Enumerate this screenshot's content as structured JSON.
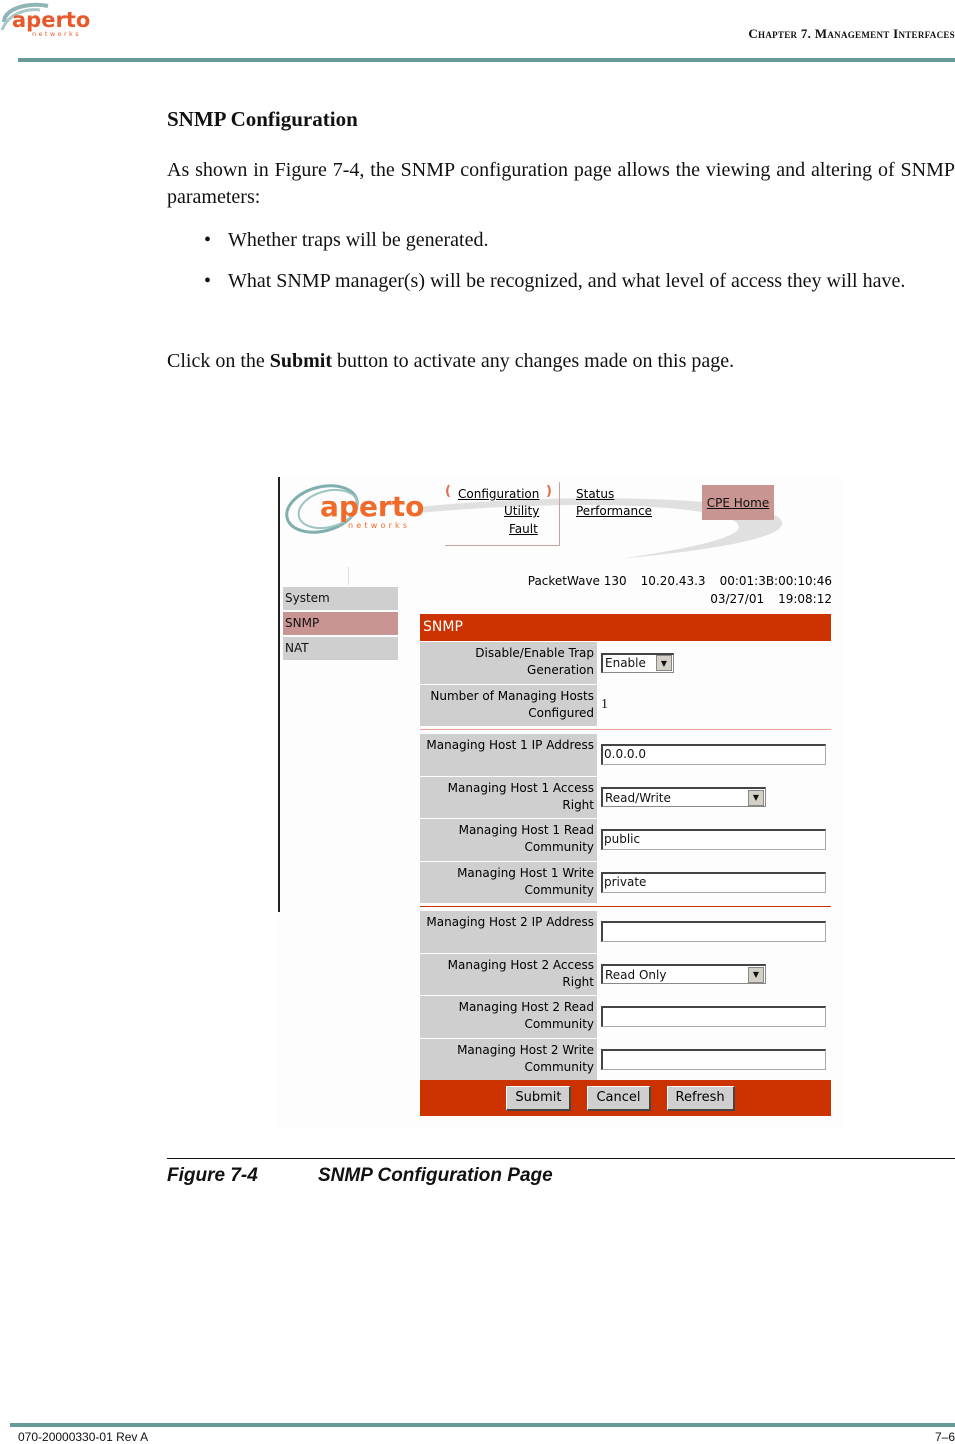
{
  "header": {
    "logo_text": "aperto",
    "logo_subtext": "networks",
    "chapter": "Chapter 7.  Management Interfaces"
  },
  "section_title": "SNMP Configuration",
  "intro": "As shown in Figure 7-4, the SNMP configuration page allows the viewing and altering of SNMP parameters:",
  "bullets": [
    "Whether traps will be generated.",
    "What SNMP manager(s) will be recognized, and what level of access they will have."
  ],
  "instruction": {
    "before": "Click on the ",
    "bold": "Submit",
    "after": " button to activate any changes made on this page."
  },
  "screenshot": {
    "logo_text": "aperto",
    "logo_subtext": "networks",
    "top_nav": {
      "configuration": "Configuration",
      "utility": "Utility",
      "fault": "Fault",
      "status": "Status",
      "performance": "Performance",
      "cpe_home": "CPE Home"
    },
    "device": {
      "model": "PacketWave 130",
      "ip": "10.20.43.3",
      "mac": "00:01:3B:00:10:46",
      "date": "03/27/01",
      "time": "19:08:12"
    },
    "side_menu": [
      {
        "label": "System",
        "active": false
      },
      {
        "label": "SNMP",
        "active": true
      },
      {
        "label": "NAT",
        "active": false
      }
    ],
    "panel_title": "SNMP",
    "trap": {
      "label": "Disable/Enable Trap Generation",
      "value": "Enable"
    },
    "num_hosts": {
      "label": "Number of Managing Hosts Configured",
      "value": "1"
    },
    "host1": {
      "ip_label": "Managing Host 1 IP Address",
      "ip_value": "0.0.0.0",
      "access_label": "Managing Host 1 Access Right",
      "access_value": "Read/Write",
      "read_label": "Managing Host 1 Read Community",
      "read_value": "public",
      "write_label": "Managing Host 1 Write Community",
      "write_value": "private"
    },
    "host2": {
      "ip_label": "Managing Host 2 IP Address",
      "ip_value": "",
      "access_label": "Managing Host 2 Access Right",
      "access_value": "Read Only",
      "read_label": "Managing Host 2 Read Community",
      "read_value": "",
      "write_label": "Managing Host 2 Write Community",
      "write_value": ""
    },
    "buttons": {
      "submit": "Submit",
      "cancel": "Cancel",
      "refresh": "Refresh"
    },
    "colors": {
      "accent": "#cc3300",
      "menu_active": "#c99592",
      "label_bg": "#cfcfcf"
    }
  },
  "caption": {
    "number": "Figure 7-4",
    "title": "SNMP Configuration Page"
  },
  "footer": {
    "doc_id": "070-20000330-01 Rev A",
    "page": "7–6"
  }
}
